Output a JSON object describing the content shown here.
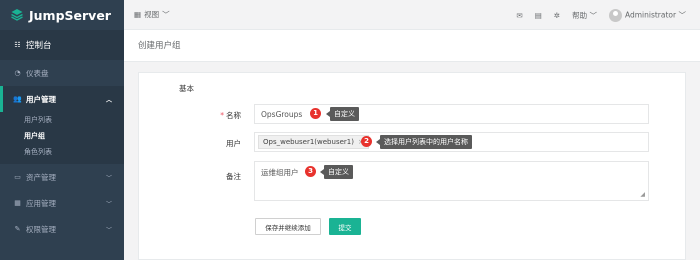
{
  "brand": {
    "name": "JumpServer"
  },
  "sidebar": {
    "dashboard": {
      "label": "控制台",
      "icon": "gauge-icon"
    },
    "items": [
      {
        "label": "仪表盘",
        "icon": "dashboard-icon"
      },
      {
        "label": "用户管理",
        "icon": "users-icon",
        "expanded": true,
        "children": [
          "用户列表",
          "用户组",
          "角色列表"
        ],
        "active_child": "用户组"
      },
      {
        "label": "资产管理",
        "icon": "inbox-icon"
      },
      {
        "label": "应用管理",
        "icon": "grid-icon"
      },
      {
        "label": "权限管理",
        "icon": "edit-icon"
      }
    ]
  },
  "topbar": {
    "view_label": "视图",
    "help_label": "帮助",
    "user_name": "Administrator"
  },
  "page": {
    "title": "创建用户组"
  },
  "form": {
    "section": "基本",
    "name_label": "名称",
    "name_value": "OpsGroups",
    "users_label": "用户",
    "user_tag": "Ops_webuser1(webuser1)",
    "tag_remove": "×",
    "comment_label": "备注",
    "comment_value": "运维组用户",
    "save_continue": "保存并继续添加",
    "submit": "提交"
  },
  "annotations": [
    {
      "num": "1",
      "text": "自定义"
    },
    {
      "num": "2",
      "text": "选择用户列表中的用户名称"
    },
    {
      "num": "3",
      "text": "自定义"
    }
  ],
  "colors": {
    "sidebar": "#2f4050",
    "accent": "#1ab394",
    "badge": "#e8322d",
    "callout": "#5a5a5a"
  }
}
